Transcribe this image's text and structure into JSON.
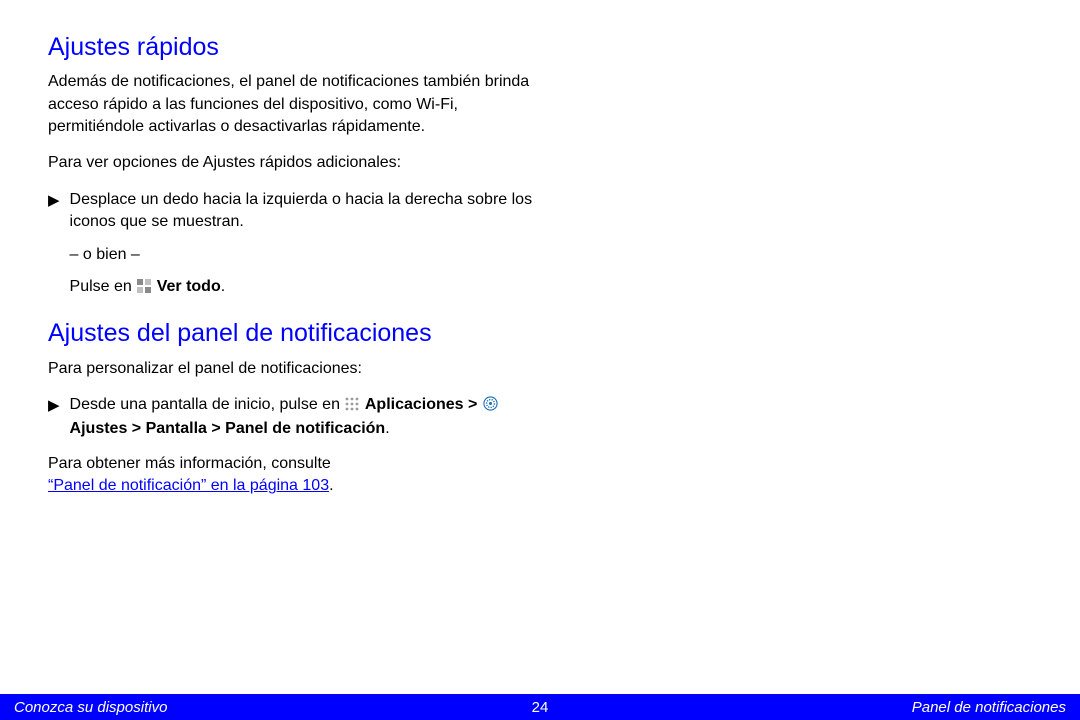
{
  "section1": {
    "heading": "Ajustes rápidos",
    "para1": "Además de notificaciones, el panel de notificaciones también brinda acceso rápido a las funciones del dispositivo, como Wi-Fi, permitiéndole activarlas o desactivarlas rápidamente.",
    "para2": "Para ver opciones de Ajustes rápidos adicionales:",
    "bullet1_a": "Desplace un dedo hacia la izquierda o hacia la derecha sobre los iconos que se muestran.",
    "bullet1_b": "– o bien –",
    "bullet1_c_pre": "Pulse en ",
    "bullet1_c_bold": " Ver todo",
    "bullet1_c_post": "."
  },
  "section2": {
    "heading": "Ajustes del panel de notificaciones",
    "para1": "Para personalizar el panel de notificaciones:",
    "bullet_pre": "Desde una pantalla de inicio, pulse en ",
    "bullet_bold1": "Aplicaciones",
    "bullet_sep1": " > ",
    "bullet_bold2": " Ajustes",
    "bullet_sep2": " > ",
    "bullet_bold3": "Pantalla",
    "bullet_sep3": " > ",
    "bullet_bold4": "Panel de notificación",
    "bullet_end": ".",
    "para2_pre": "Para obtener más información, consulte ",
    "para2_link": "“Panel de notificación” en la página 103",
    "para2_post": "."
  },
  "footer": {
    "left": "Conozca su dispositivo",
    "page": "24",
    "right": "Panel de notificaciones"
  },
  "icons": {
    "arrow": "▶",
    "grid": "grid-icon",
    "apps": "apps-grid-icon",
    "settings": "settings-gear-icon"
  }
}
